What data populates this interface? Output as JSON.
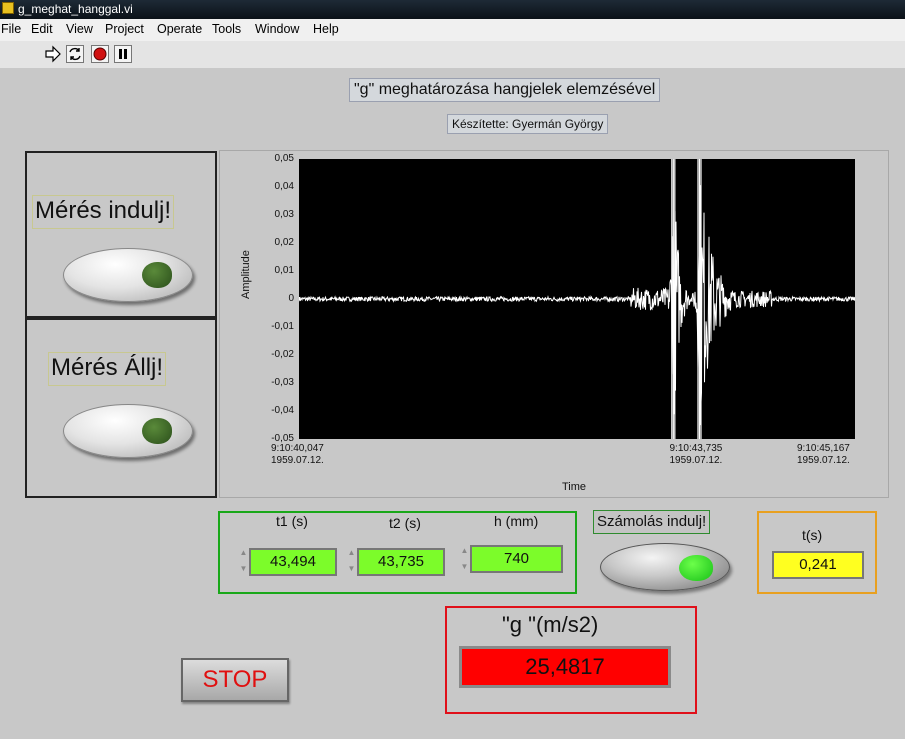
{
  "window": {
    "title": "g_meghat_hanggal.vi"
  },
  "menu": [
    "File",
    "Edit",
    "View",
    "Project",
    "Operate",
    "Tools",
    "Window",
    "Help"
  ],
  "toolbar": {
    "icons": [
      "run-arrow-icon",
      "run-continuously-icon",
      "abort-icon",
      "pause-icon"
    ]
  },
  "header": {
    "title": "\"g\" meghatározása hangjelek elemzésével",
    "author": "Készítette: Gyermán György"
  },
  "buttons": {
    "start_label": "Mérés indulj!",
    "stop_meas_label": "Mérés Állj!",
    "calc_label": "Számolás indulj!",
    "stop_label": "STOP"
  },
  "controls": {
    "t1": {
      "label": "t1 (s)",
      "value": "43,494"
    },
    "t2": {
      "label": "t2 (s)",
      "value": "43,735"
    },
    "h": {
      "label": "h (mm)",
      "value": "740"
    }
  },
  "indicators": {
    "t": {
      "label": "t(s)",
      "value": "0,241"
    },
    "g": {
      "label": "\"g \"(m/s2)",
      "value": "25,4817"
    }
  },
  "colors": {
    "graph_bg": "#000000",
    "trace": "#ffffff",
    "control_green": "#7cfc2a",
    "indicator_yellow": "#ffff20",
    "indicator_red": "#ff0000"
  },
  "chart_data": {
    "type": "line",
    "xlabel": "Time",
    "ylabel": "Amplitude",
    "ylim": [
      -0.05,
      0.05
    ],
    "y_ticks": [
      "0,05",
      "0,04",
      "0,03",
      "0,02",
      "0,01",
      "0",
      "-0,01",
      "-0,02",
      "-0,03",
      "-0,04",
      "-0,05"
    ],
    "x_ticks": [
      {
        "time": "9:10:40,047",
        "date": "1959.07.12."
      },
      {
        "time": "9:10:43,735",
        "date": "1959.07.12."
      },
      {
        "time": "9:10:45,167",
        "date": "1959.07.12."
      }
    ],
    "x_range_s": [
      40.047,
      45.167
    ],
    "series": [
      {
        "bursts": [
          {
            "t": 43.494,
            "amp": 0.05,
            "width_s": 0.15
          },
          {
            "t": 43.735,
            "amp": 0.05,
            "width_s": 0.35
          }
        ],
        "noise": 0.0008
      }
    ],
    "grid": false
  }
}
